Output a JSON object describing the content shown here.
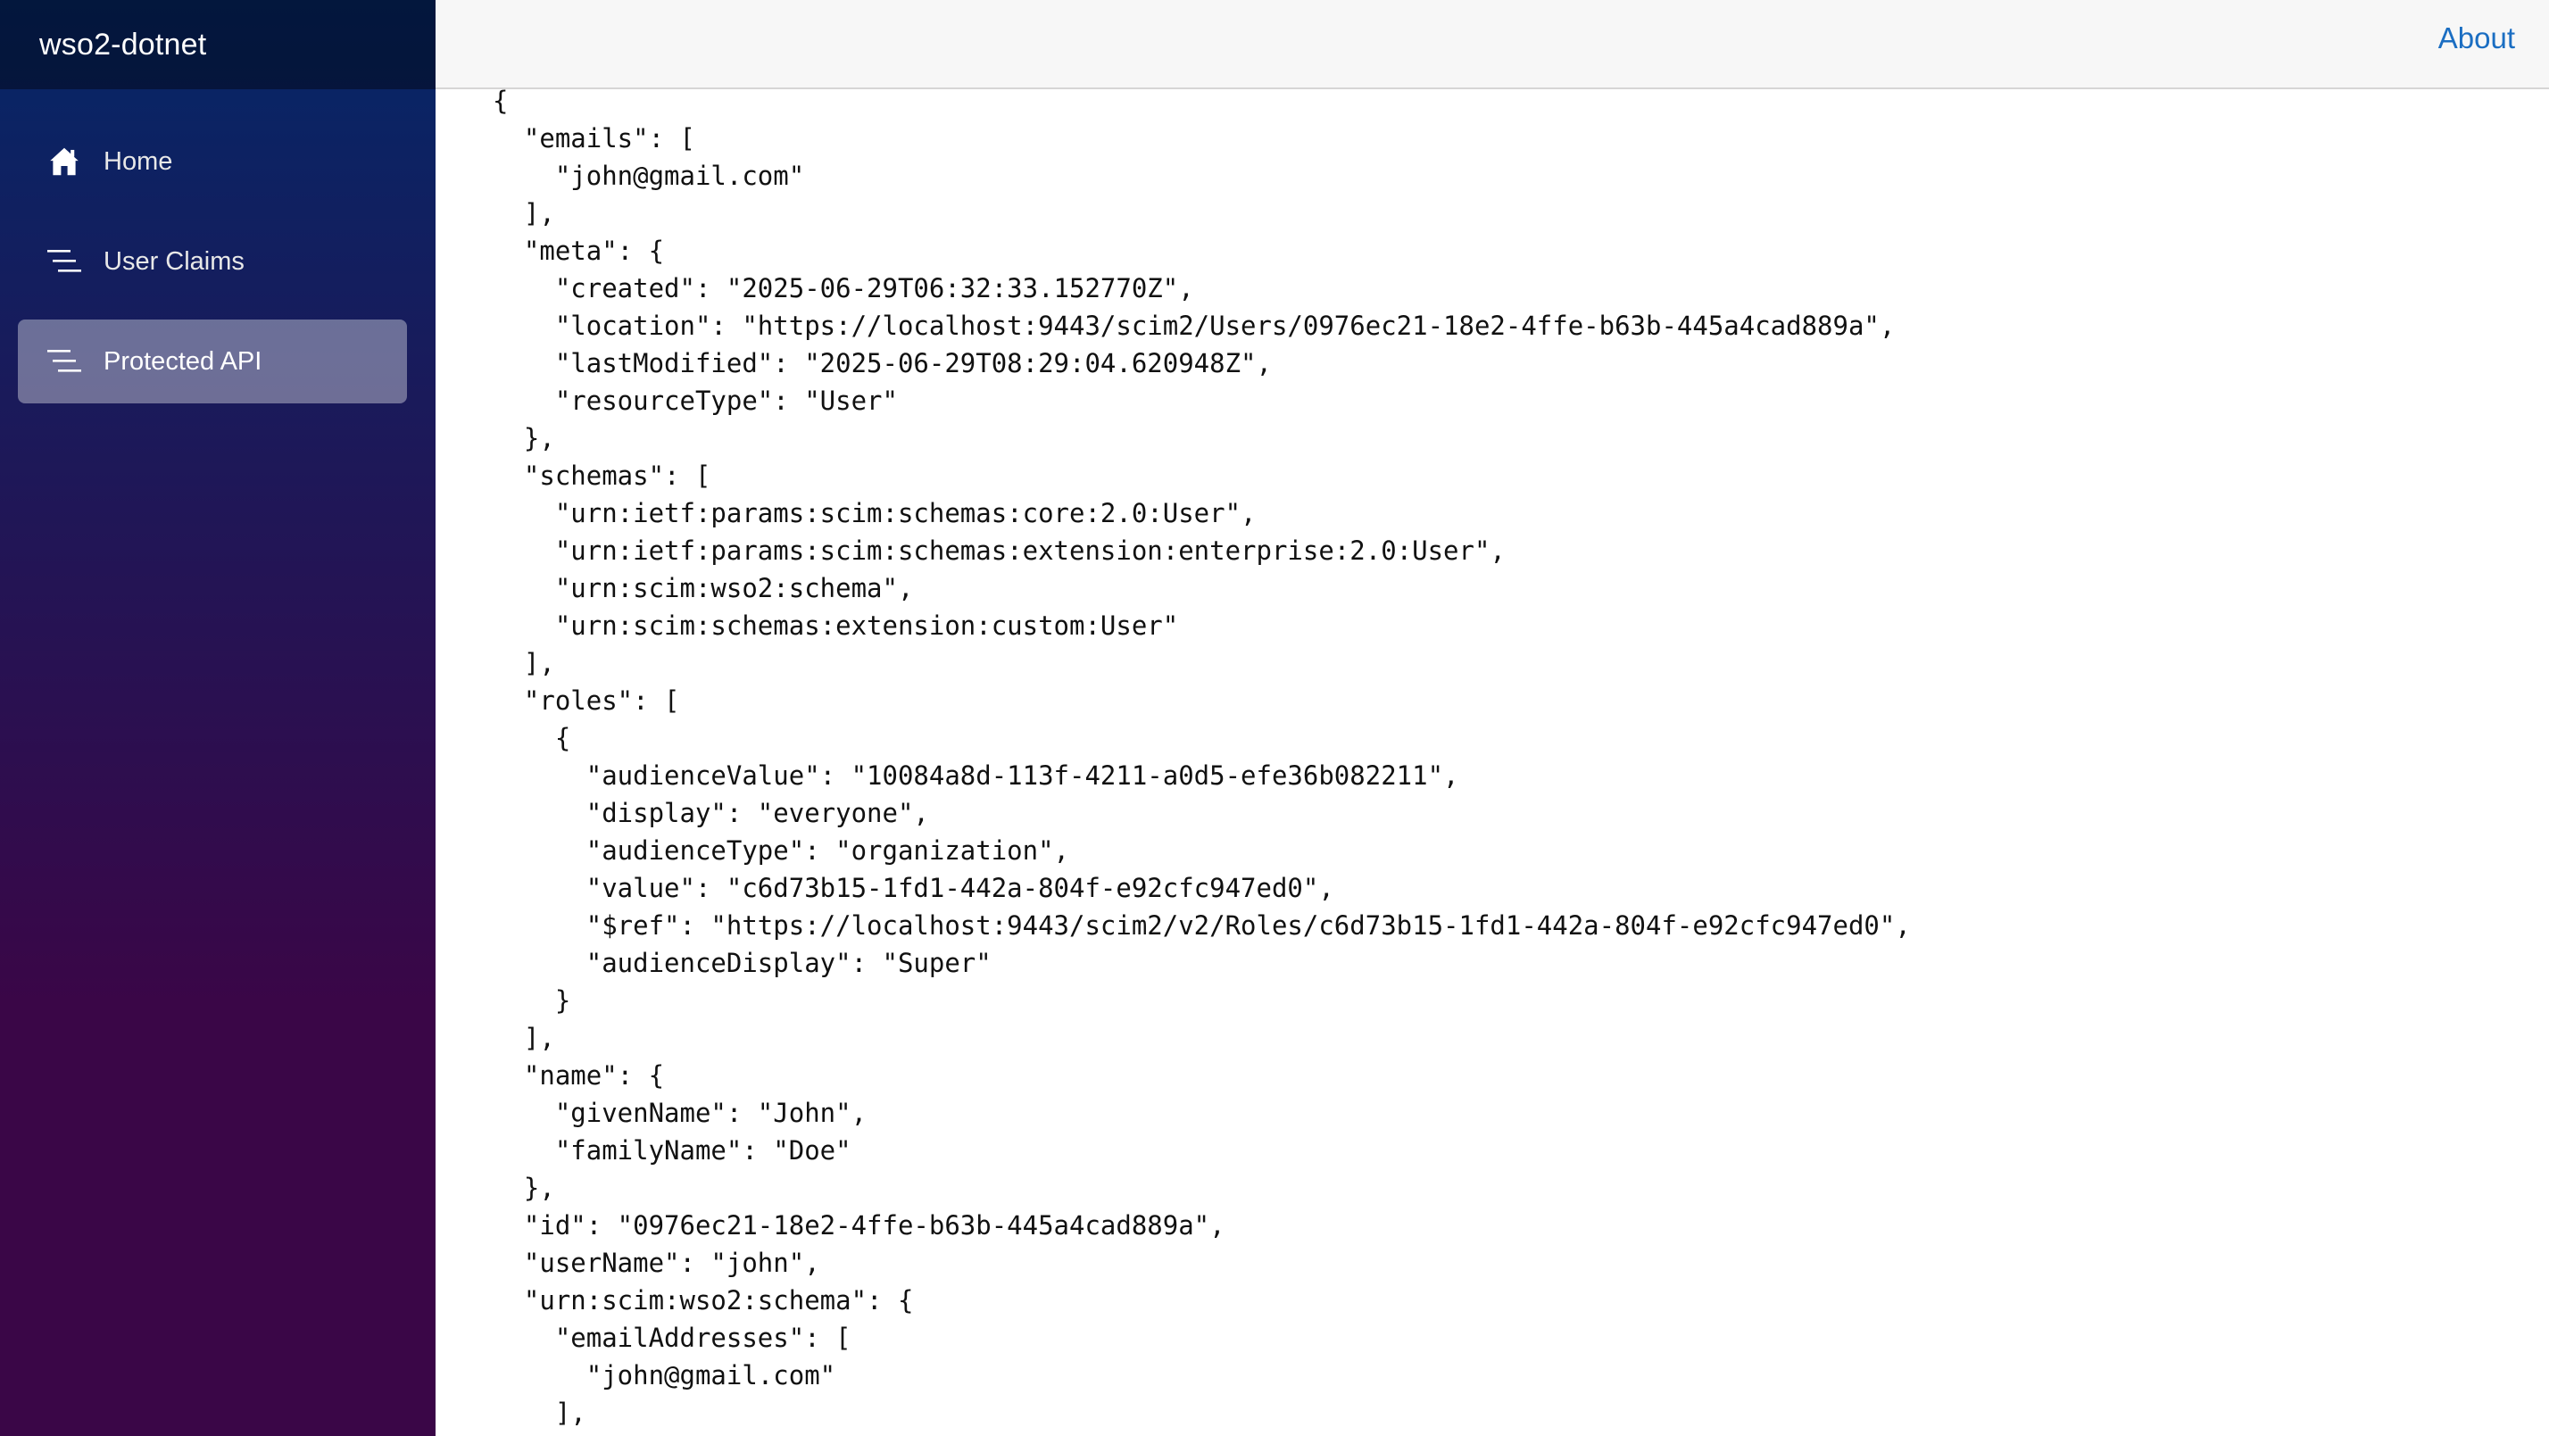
{
  "app": {
    "brand": "wso2-dotnet"
  },
  "sidebar": {
    "items": [
      {
        "label": "Home",
        "icon": "home-icon",
        "active": false
      },
      {
        "label": "User Claims",
        "icon": "list-icon",
        "active": false
      },
      {
        "label": "Protected API",
        "icon": "list-icon",
        "active": true
      }
    ]
  },
  "topbar": {
    "about_label": "About"
  },
  "colors": {
    "sidebar_gradient_top": "#052767",
    "sidebar_gradient_bottom": "#3a0647",
    "link": "#1b6ec2",
    "topbar_bg": "#f7f7f7"
  },
  "content": {
    "json_lines": [
      "{",
      "  \"emails\": [",
      "    \"john@gmail.com\"",
      "  ],",
      "  \"meta\": {",
      "    \"created\": \"2025-06-29T06:32:33.152770Z\",",
      "    \"location\": \"https://localhost:9443/scim2/Users/0976ec21-18e2-4ffe-b63b-445a4cad889a\",",
      "    \"lastModified\": \"2025-06-29T08:29:04.620948Z\",",
      "    \"resourceType\": \"User\"",
      "  },",
      "  \"schemas\": [",
      "    \"urn:ietf:params:scim:schemas:core:2.0:User\",",
      "    \"urn:ietf:params:scim:schemas:extension:enterprise:2.0:User\",",
      "    \"urn:scim:wso2:schema\",",
      "    \"urn:scim:schemas:extension:custom:User\"",
      "  ],",
      "  \"roles\": [",
      "    {",
      "      \"audienceValue\": \"10084a8d-113f-4211-a0d5-efe36b082211\",",
      "      \"display\": \"everyone\",",
      "      \"audienceType\": \"organization\",",
      "      \"value\": \"c6d73b15-1fd1-442a-804f-e92cfc947ed0\",",
      "      \"$ref\": \"https://localhost:9443/scim2/v2/Roles/c6d73b15-1fd1-442a-804f-e92cfc947ed0\",",
      "      \"audienceDisplay\": \"Super\"",
      "    }",
      "  ],",
      "  \"name\": {",
      "    \"givenName\": \"John\",",
      "    \"familyName\": \"Doe\"",
      "  },",
      "  \"id\": \"0976ec21-18e2-4ffe-b63b-445a4cad889a\",",
      "  \"userName\": \"john\",",
      "  \"urn:scim:wso2:schema\": {",
      "    \"emailAddresses\": [",
      "      \"john@gmail.com\"",
      "    ],"
    ]
  }
}
